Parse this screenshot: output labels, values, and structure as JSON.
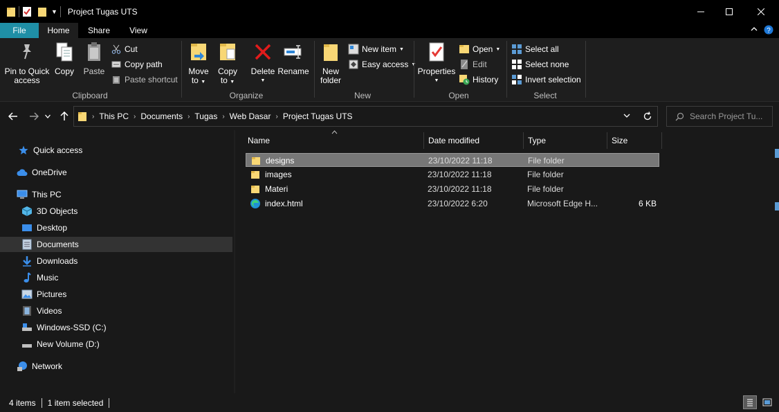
{
  "window": {
    "title": "Project Tugas UTS",
    "controls": {
      "minimize": "—",
      "maximize": "☐",
      "close": "✕"
    }
  },
  "ribbon_tabs": [
    {
      "label": "File"
    },
    {
      "label": "Home"
    },
    {
      "label": "Share"
    },
    {
      "label": "View"
    }
  ],
  "ribbon": {
    "clipboard": {
      "group_label": "Clipboard",
      "pin_label_1": "Pin to Quick",
      "pin_label_2": "access",
      "copy_label": "Copy",
      "paste_label": "Paste",
      "cut_label": "Cut",
      "copy_path_label": "Copy path",
      "paste_shortcut_label": "Paste shortcut"
    },
    "organize": {
      "group_label": "Organize",
      "move_to_label_1": "Move",
      "move_to_label_2": "to",
      "copy_to_label_1": "Copy",
      "copy_to_label_2": "to",
      "delete_label": "Delete",
      "rename_label": "Rename"
    },
    "new": {
      "group_label": "New",
      "new_folder_label_1": "New",
      "new_folder_label_2": "folder",
      "new_item_label": "New item",
      "easy_access_label": "Easy access"
    },
    "open": {
      "group_label": "Open",
      "properties_label": "Properties",
      "open_label": "Open",
      "edit_label": "Edit",
      "history_label": "History"
    },
    "select": {
      "group_label": "Select",
      "select_all_label": "Select all",
      "select_none_label": "Select none",
      "invert_selection_label": "Invert selection"
    }
  },
  "breadcrumb": [
    "This PC",
    "Documents",
    "Tugas",
    "Web Dasar",
    "Project Tugas UTS"
  ],
  "search": {
    "placeholder": "Search Project Tu..."
  },
  "nav_pane": {
    "quick_access": "Quick access",
    "onedrive": "OneDrive",
    "this_pc": "This PC",
    "items": [
      {
        "label": "3D Objects"
      },
      {
        "label": "Desktop"
      },
      {
        "label": "Documents"
      },
      {
        "label": "Downloads"
      },
      {
        "label": "Music"
      },
      {
        "label": "Pictures"
      },
      {
        "label": "Videos"
      },
      {
        "label": "Windows-SSD (C:)"
      },
      {
        "label": "New Volume (D:)"
      }
    ],
    "network": "Network"
  },
  "file_list": {
    "columns": {
      "name": "Name",
      "date": "Date modified",
      "type": "Type",
      "size": "Size"
    },
    "rows": [
      {
        "name": "designs",
        "date": "23/10/2022 11:18",
        "type": "File folder",
        "size": "",
        "icon": "folder-icon",
        "selected": true
      },
      {
        "name": "images",
        "date": "23/10/2022 11:18",
        "type": "File folder",
        "size": "",
        "icon": "folder-icon",
        "selected": false
      },
      {
        "name": "Materi",
        "date": "23/10/2022 11:18",
        "type": "File folder",
        "size": "",
        "icon": "folder-icon",
        "selected": false
      },
      {
        "name": "index.html",
        "date": "23/10/2022 6:20",
        "type": "Microsoft Edge H...",
        "size": "6 KB",
        "icon": "edge-icon",
        "selected": false
      }
    ]
  },
  "status": {
    "item_count": "4 items",
    "selected": "1 item selected"
  },
  "colors": {
    "accent": "#1f8fa6",
    "folder": "#f8d775",
    "selection": "#777777",
    "background": "#191919"
  }
}
